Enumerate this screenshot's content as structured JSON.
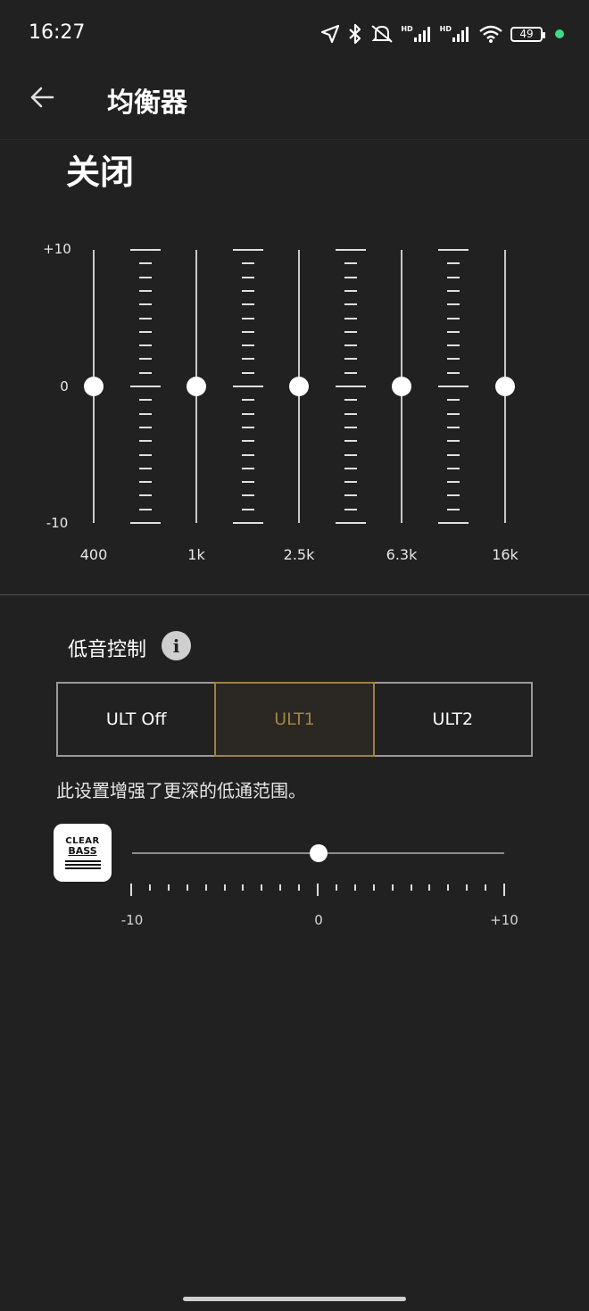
{
  "status_bar": {
    "time": "16:27",
    "battery": "49",
    "hd1": "HD",
    "hd2": "HD",
    "icons": [
      "location-icon",
      "bluetooth-icon",
      "mute-icon",
      "signal-icon",
      "signal-icon",
      "wifi-icon",
      "battery-icon",
      "active-dot"
    ]
  },
  "header": {
    "title": "均衡器"
  },
  "preset": {
    "label": "关闭"
  },
  "equalizer": {
    "scale": {
      "top": "+10",
      "mid": "0",
      "bottom": "-10"
    },
    "bands": [
      {
        "freq": "400",
        "value": 0
      },
      {
        "freq": "1k",
        "value": 0
      },
      {
        "freq": "2.5k",
        "value": 0
      },
      {
        "freq": "6.3k",
        "value": 0
      },
      {
        "freq": "16k",
        "value": 0
      }
    ]
  },
  "bass": {
    "title": "低音控制",
    "info_glyph": "i",
    "modes": [
      {
        "label": "ULT Off",
        "selected": false
      },
      {
        "label": "ULT1",
        "selected": true
      },
      {
        "label": "ULT2",
        "selected": false
      }
    ],
    "description": "此设置增强了更深的低通范围。"
  },
  "clear_bass": {
    "logo_line1": "CLEAR",
    "logo_line2": "BASS",
    "value": 0,
    "min_label": "-10",
    "mid_label": "0",
    "max_label": "+10"
  },
  "colors": {
    "background": "#212121",
    "accent": "#a08445"
  }
}
